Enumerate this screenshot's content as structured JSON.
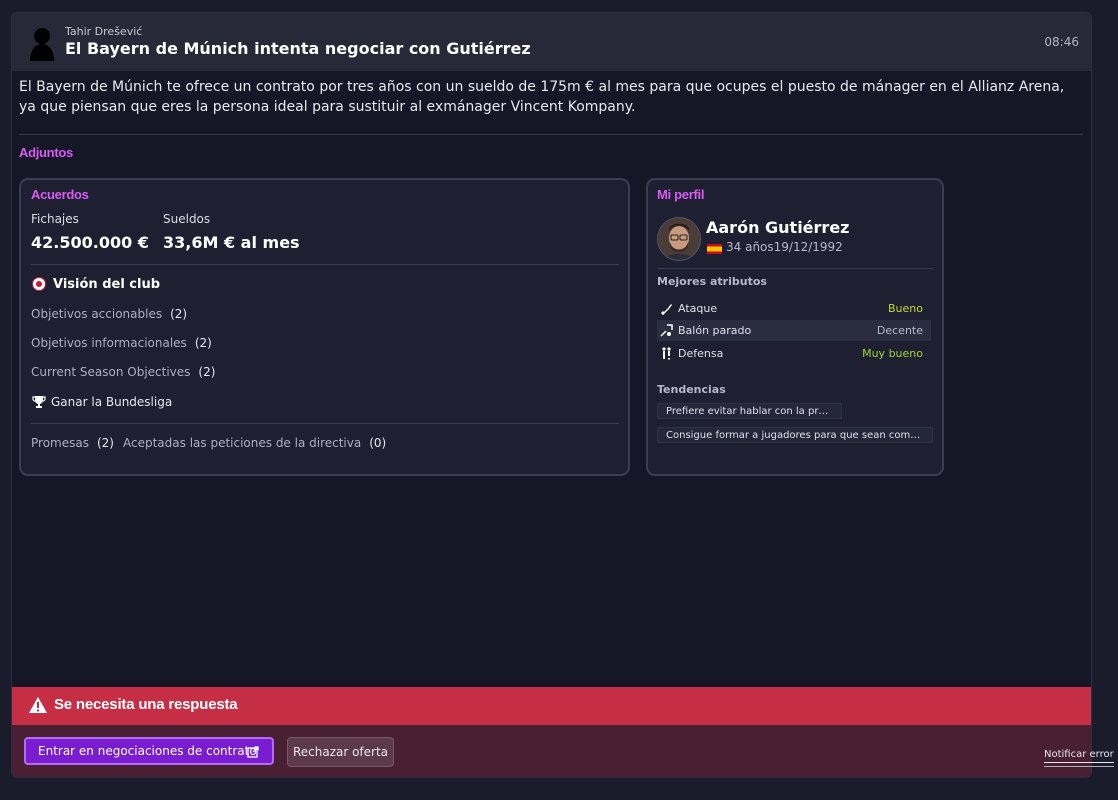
{
  "message": {
    "sender": "Tahir Drešević",
    "subject": "El Bayern de Múnich intenta negociar con Gutiérrez",
    "time": "08:46",
    "body": "El Bayern de Múnich te ofrece un contrato por tres años con un sueldo de 175m € al mes para que ocupes el puesto de mánager en el Allianz Arena, ya que piensan que eres la persona ideal para sustituir al exmánager Vincent Kompany."
  },
  "attachments_label": "Adjuntos",
  "agreements": {
    "title": "Acuerdos",
    "transfers_label": "Fichajes",
    "transfers_value": "42.500.000 €",
    "wages_label": "Sueldos",
    "wages_value": "33,6M € al mes",
    "club_vision_label": "Visión del club",
    "objectives": [
      {
        "label": "Objetivos accionables",
        "count": "(2)"
      },
      {
        "label": "Objetivos informacionales",
        "count": "(2)"
      },
      {
        "label": "Current Season Objectives",
        "count": "(2)"
      }
    ],
    "trophy_objective": "Ganar la Bundesliga",
    "promises_label": "Promesas",
    "promises_count": "(2)",
    "accepted_label": "Aceptadas las peticiones de la directiva",
    "accepted_count": "(0)"
  },
  "profile": {
    "title": "Mi perfil",
    "name": "Aarón Gutiérrez",
    "age_dob": "34 años19/12/1992",
    "best_attributes_label": "Mejores atributos",
    "attributes": [
      {
        "name": "Ataque",
        "value": "Bueno",
        "icon": "attack-icon"
      },
      {
        "name": "Balón parado",
        "value": "Decente",
        "icon": "set-piece-icon"
      },
      {
        "name": "Defensa",
        "value": "Muy bueno",
        "icon": "defense-icon"
      }
    ],
    "tendencies_label": "Tendencias",
    "tendencies": [
      "Prefiere evitar hablar con la prensa",
      "Consigue formar a jugadores para que sean compet..."
    ]
  },
  "footer": {
    "response_needed": "Se necesita una respuesta",
    "negotiate_button": "Entrar en negociaciones de contrato",
    "reject_button": "Rechazar oferta",
    "report_link": "Notificar error"
  },
  "colors": {
    "accent_purple": "#d65cf2",
    "primary_button": "#7a1ccf",
    "alert_red": "#c52e45",
    "good": "#c6d630",
    "very_good": "#9ed631"
  }
}
